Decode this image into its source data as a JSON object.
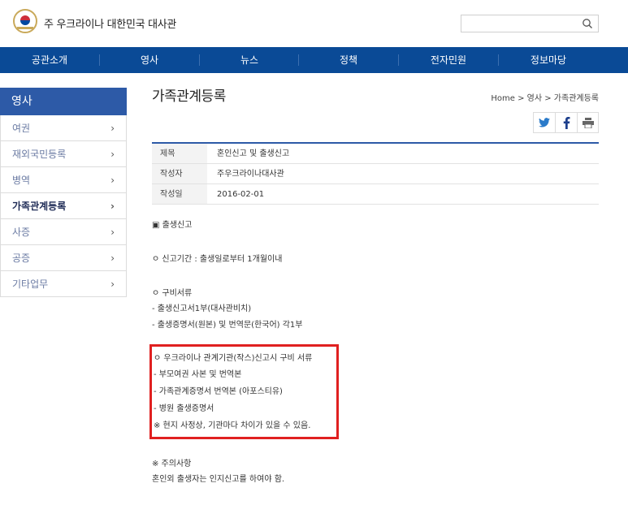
{
  "header": {
    "site_title": "주 우크라이나 대한민국 대사관",
    "search_placeholder": ""
  },
  "nav": {
    "items": [
      "공관소개",
      "영사",
      "뉴스",
      "정책",
      "전자민원",
      "정보마당"
    ]
  },
  "sidebar": {
    "title": "영사",
    "items": [
      {
        "label": "여권",
        "active": false
      },
      {
        "label": "재외국민등록",
        "active": false
      },
      {
        "label": "병역",
        "active": false
      },
      {
        "label": "가족관계등록",
        "active": true
      },
      {
        "label": "사증",
        "active": false
      },
      {
        "label": "공증",
        "active": false
      },
      {
        "label": "기타업무",
        "active": false
      }
    ],
    "chevron": "›"
  },
  "content": {
    "title": "가족관계등록",
    "breadcrumb": "Home > 영사 > 가족관계등록",
    "share": [
      "twitter-icon",
      "facebook-icon",
      "print-icon"
    ],
    "meta": [
      {
        "label": "제목",
        "value": "혼인신고 및 출생신고"
      },
      {
        "label": "작성자",
        "value": "주우크라이나대사관"
      },
      {
        "label": "작성일",
        "value": "2016-02-01"
      }
    ],
    "body": {
      "section_title": "▣ 출생신고",
      "period": "ㅇ 신고기간 : 출생일로부터 1개월이내",
      "docs_title": "ㅇ 구비서류",
      "doc1": " - 출생신고서1부(대사관비치)",
      "doc2": " - 출생증명서(원본) 및 번역문(한국어) 각1부",
      "ua_title": "ㅇ 우크라이나 관계기관(작스)신고시 구비 서류",
      "ua1": " -  부모여권 사본 및 번역본",
      "ua2": " -  가족관계증명서 번역본 (아포스티유)",
      "ua3": " -  병원 출생증명서",
      "ua_note": "※ 현지 사정상, 기관마다 차이가 있을 수 있음.",
      "caution_title": "※  주의사항",
      "caution_text": "   혼인외 출생자는 인지신고를 하여야 함."
    }
  },
  "colors": {
    "nav_bg": "#0a4a96",
    "sidebar_head": "#2d5aa7",
    "highlight_border": "#e02020"
  }
}
